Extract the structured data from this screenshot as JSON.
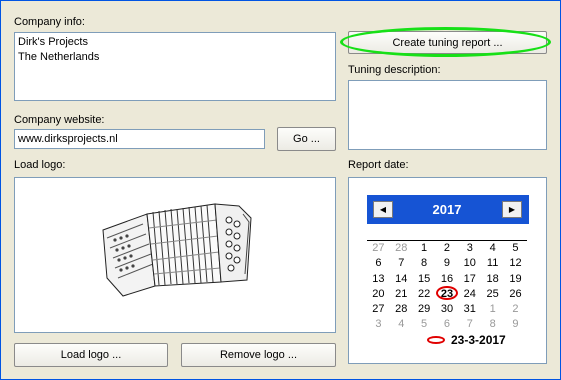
{
  "company_info": {
    "label": "Company info:",
    "lines": [
      "Dirk's Projects",
      "The Netherlands"
    ]
  },
  "company_website": {
    "label": "Company website:",
    "value": "www.dirksprojects.nl",
    "go_label": "Go ..."
  },
  "logo": {
    "label": "Load logo:",
    "image_icon": "accordion-icon",
    "load_label": "Load logo ...",
    "remove_label": "Remove logo ..."
  },
  "tuning": {
    "create_report_label": "Create tuning report ...",
    "description_label": "Tuning description:",
    "description_value": ""
  },
  "report_date": {
    "label": "Report date:",
    "calendar": {
      "year": "2017",
      "prev_icon": "left-arrow-icon",
      "next_icon": "right-arrow-icon",
      "weeks": [
        [
          {
            "d": "27",
            "o": true
          },
          {
            "d": "28",
            "o": true
          },
          {
            "d": "1"
          },
          {
            "d": "2"
          },
          {
            "d": "3"
          },
          {
            "d": "4"
          },
          {
            "d": "5"
          }
        ],
        [
          {
            "d": "6"
          },
          {
            "d": "7"
          },
          {
            "d": "8"
          },
          {
            "d": "9"
          },
          {
            "d": "10"
          },
          {
            "d": "11"
          },
          {
            "d": "12"
          }
        ],
        [
          {
            "d": "13"
          },
          {
            "d": "14"
          },
          {
            "d": "15"
          },
          {
            "d": "16"
          },
          {
            "d": "17"
          },
          {
            "d": "18"
          },
          {
            "d": "19"
          }
        ],
        [
          {
            "d": "20"
          },
          {
            "d": "21"
          },
          {
            "d": "22"
          },
          {
            "d": "23",
            "t": true
          },
          {
            "d": "24"
          },
          {
            "d": "25"
          },
          {
            "d": "26"
          }
        ],
        [
          {
            "d": "27"
          },
          {
            "d": "28"
          },
          {
            "d": "29"
          },
          {
            "d": "30"
          },
          {
            "d": "31"
          },
          {
            "d": "1",
            "o": true
          },
          {
            "d": "2",
            "o": true
          }
        ],
        [
          {
            "d": "3",
            "o": true
          },
          {
            "d": "4",
            "o": true
          },
          {
            "d": "5",
            "o": true
          },
          {
            "d": "6",
            "o": true
          },
          {
            "d": "7",
            "o": true
          },
          {
            "d": "8",
            "o": true
          },
          {
            "d": "9",
            "o": true
          }
        ]
      ],
      "today_text": "23-3-2017"
    }
  },
  "colors": {
    "background": "#ece9d8",
    "calendar_header": "#1654d4",
    "highlight_green": "#17e017",
    "today_red": "#e00000"
  }
}
